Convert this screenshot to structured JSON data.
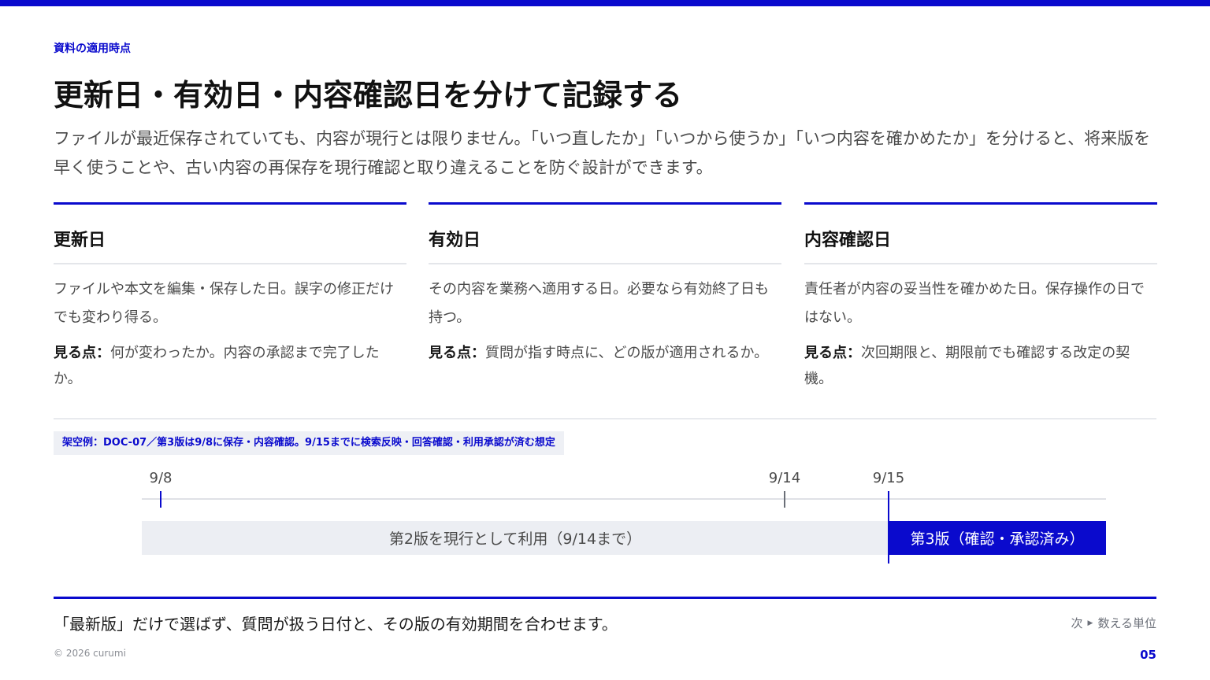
{
  "eyebrow": "資料の適用時点",
  "title": "更新日・有効日・内容確認日を分けて記録する",
  "lead": "ファイルが最近保存されていても、内容が現行とは限りません。「いつ直したか」「いつから使うか」「いつ内容を確かめたか」を分けると、将来版を早く使うことや、古い内容の再保存を現行確認と取り違えることを防ぐ設計ができます。",
  "columns": [
    {
      "heading": "更新日",
      "desc": "ファイルや本文を編集・保存した日。誤字の修正だけでも変わり得る。",
      "point_label": "見る点：",
      "point_text": "何が変わったか。内容の承認まで完了したか。"
    },
    {
      "heading": "有効日",
      "desc": "その内容を業務へ適用する日。必要なら有効終了日も持つ。",
      "point_label": "見る点：",
      "point_text": "質問が指す時点に、どの版が適用されるか。"
    },
    {
      "heading": "内容確認日",
      "desc": "責任者が内容の妥当性を確かめた日。保存操作の日ではない。",
      "point_label": "見る点：",
      "point_text": "次回期限と、期限前でも確認する改定の契機。"
    }
  ],
  "example": "架空例：DOC-07／第3版は9/8に保存・内容確認。9/15までに検索反映・回答確認・利用承認が済む想定",
  "timeline": {
    "ticks": [
      {
        "label": "9/8",
        "style": "accent"
      },
      {
        "label": "9/14",
        "style": "gray"
      },
      {
        "label": "9/15",
        "style": "accent"
      }
    ],
    "bar_old": "第2版を現行として利用（9/14まで）",
    "bar_new": "第3版（確認・承認済み）"
  },
  "footer": {
    "message": "「最新版」だけで選ばず、質問が扱う日付と、その版の有効期間を合わせます。",
    "next_label": "次",
    "next_text": "数える単位",
    "copyright": "© 2026 curumi",
    "page": "05"
  },
  "colors": {
    "accent": "#0a0acd",
    "muted_bar": "#eceef3"
  }
}
